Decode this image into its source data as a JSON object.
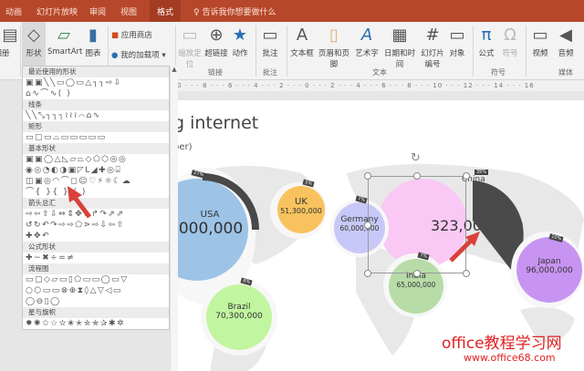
{
  "tabs": [
    "动画",
    "幻灯片放映",
    "审阅",
    "视图",
    "格式"
  ],
  "tell_me": "告诉我你想要做什么",
  "ribbon": {
    "left_cut": "相册",
    "shapes": "形状",
    "smartart": "SmartArt",
    "chart": "图表",
    "store": "应用商店",
    "addins": "我的加载项",
    "zoom": "缩放定位",
    "hyperlink": "超链接",
    "action": "动作",
    "group_links": "链接",
    "comment": "批注",
    "group_comments": "批注",
    "textbox": "文本框",
    "header_footer": "页眉和页脚",
    "wordart": "艺术字",
    "datetime": "日期和时间",
    "slide_number": "幻灯片编号",
    "object": "对象",
    "group_text": "文本",
    "equation": "公式",
    "symbol": "符号",
    "group_symbols": "符号",
    "video": "视频",
    "audio": "音频",
    "group_media": "媒体"
  },
  "ruler": "0 · · · 8 · · · 6 · · · 4 · · · 2 · · · 0 · · · 2 · · · 4 · · · 6 · · · 8 · · · 10 · · · 12 · · · 14 · · · 16",
  "gallery": {
    "sections": [
      {
        "title": "最近使用的形状",
        "rows": [
          "▣▣╲╲▭◯▭△┐┐⇨⇩",
          "⌂∿⌒∿( )"
        ]
      },
      {
        "title": "线条",
        "rows": [
          "╲╲⤡┐┐┐≀≀≀⌒⌂∿"
        ]
      },
      {
        "title": "矩形",
        "rows": [
          "▭▢▭⌓▭▭▭▭▭"
        ]
      },
      {
        "title": "基本形状",
        "rows": [
          "▣▣◯△◺▱⏢◇⬠⬡◎◎",
          "◉◎◔◐◑▣◸L◢✚◎⌸",
          "◫▣◎◠⌒◻☺♡⚡☼☾☁",
          "⌒{ }{ } ( )"
        ]
      },
      {
        "title": "箭头总汇",
        "rows": [
          "⇨⇦⇧⇩⇔⇕✥⇫↱↷⇗⇗",
          "↺↻↶↷⇨⇨⬠⋗⇨⇩⇦⇧",
          "✚✥↶"
        ]
      },
      {
        "title": "公式形状",
        "rows": [
          "✚−✖÷=≠"
        ]
      },
      {
        "title": "流程图",
        "rows": [
          "▭▢◇▱▭▯⬠▭▭◯▭▽",
          "○⬡▭▭⊗⊕⧗◊△▽◁▭",
          "◯⊖▯◯"
        ]
      },
      {
        "title": "星与旗帜",
        "rows": [
          "✹✺✩☆✫✬✭✮✯✰✱✲"
        ]
      }
    ]
  },
  "slide": {
    "title": "g internet",
    "subtitle": "ber)",
    "countries": [
      {
        "name": "USA",
        "value": "000,000",
        "pct": "27%",
        "color": "#9dc3e6"
      },
      {
        "name": "UK",
        "value": "51,300,000",
        "pct": "5%",
        "color": "#f8c35e"
      },
      {
        "name": "Germany",
        "value": "60,000,000",
        "pct": "7%",
        "color": "#c8c8f8"
      },
      {
        "name": "China",
        "value": "323,000,000",
        "pct": "35%",
        "color": "#f9c8f4"
      },
      {
        "name": "India",
        "value": "65,000,000",
        "pct": "7%",
        "color": "#b8dca8"
      },
      {
        "name": "Brazil",
        "value": "70,300,000",
        "pct": "8%",
        "color": "#c2f5a0"
      },
      {
        "name": "Japan",
        "value": "96,000,000",
        "pct": "10%",
        "color": "#c794f2"
      }
    ]
  },
  "watermark": {
    "line1": "office教程学习网",
    "line2": "www.office68.com"
  }
}
